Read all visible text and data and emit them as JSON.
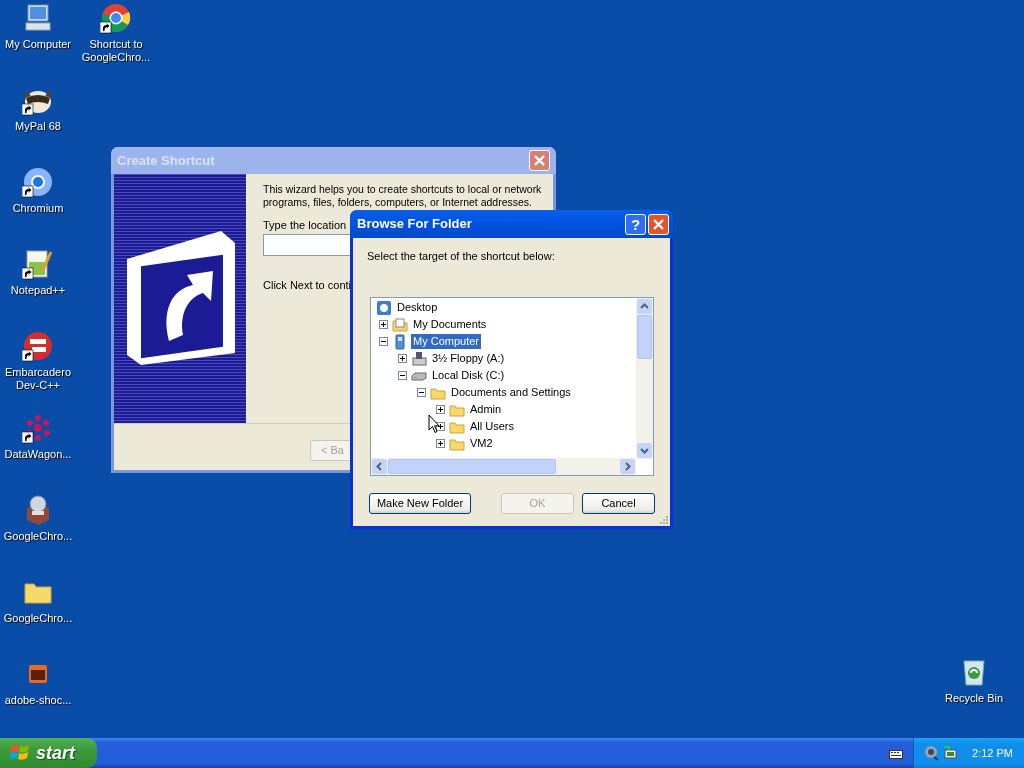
{
  "desktop_icons": [
    {
      "label": "My Computer",
      "kind": "computer",
      "shortcut": false
    },
    {
      "label": "Shortcut to GoogleChro...",
      "kind": "chrome",
      "shortcut": true
    },
    {
      "label": "MyPal 68",
      "kind": "raccoon",
      "shortcut": true
    },
    {
      "label": "Chromium",
      "kind": "chromium",
      "shortcut": true
    },
    {
      "label": "Notepad++",
      "kind": "notepad",
      "shortcut": true
    },
    {
      "label": "Embarcadero Dev-C++",
      "kind": "devcpp",
      "shortcut": true
    },
    {
      "label": "DataWagon...",
      "kind": "dots",
      "shortcut": true
    },
    {
      "label": "GoogleChro...",
      "kind": "package",
      "shortcut": false
    },
    {
      "label": "GoogleChro...",
      "kind": "folder",
      "shortcut": false
    },
    {
      "label": "adobe-shoc...",
      "kind": "adobe",
      "shortcut": false
    },
    {
      "label": "Recycle Bin",
      "kind": "recycle",
      "shortcut": false
    }
  ],
  "create_shortcut": {
    "title": "Create Shortcut",
    "intro": "This wizard helps you to create shortcuts to local or network programs, files, folders, computers, or Internet addresses.",
    "location_label": "Type the location",
    "next_hint": "Click Next to conti",
    "back_button": "< Ba"
  },
  "browse_dialog": {
    "title": "Browse For Folder",
    "help_button": "?",
    "prompt": "Select the target of the shortcut below:",
    "tree": [
      {
        "label": "Desktop",
        "kind": "desktop",
        "selected": false,
        "children": [
          {
            "label": "My Documents",
            "kind": "documents",
            "expanded": false,
            "selected": false
          },
          {
            "label": "My Computer",
            "kind": "computer",
            "expanded": true,
            "selected": true,
            "children": [
              {
                "label": "3½ Floppy (A:)",
                "kind": "floppy",
                "expanded": false,
                "selected": false
              },
              {
                "label": "Local Disk (C:)",
                "kind": "disk",
                "expanded": true,
                "selected": false,
                "children": [
                  {
                    "label": "Documents and Settings",
                    "kind": "folder",
                    "expanded": true,
                    "selected": false,
                    "children": [
                      {
                        "label": "Admin",
                        "kind": "folder",
                        "expanded": false,
                        "selected": false
                      },
                      {
                        "label": "All Users",
                        "kind": "folder",
                        "expanded": false,
                        "selected": false
                      },
                      {
                        "label": "VM2",
                        "kind": "folder",
                        "expanded": false,
                        "selected": false
                      }
                    ]
                  }
                ]
              }
            ]
          }
        ]
      }
    ],
    "buttons": [
      {
        "label": "Make New Folder",
        "disabled": false
      },
      {
        "label": "OK",
        "disabled": true
      },
      {
        "label": "Cancel",
        "disabled": false
      }
    ]
  },
  "taskbar": {
    "start": "start",
    "clock": "2:12 PM"
  }
}
